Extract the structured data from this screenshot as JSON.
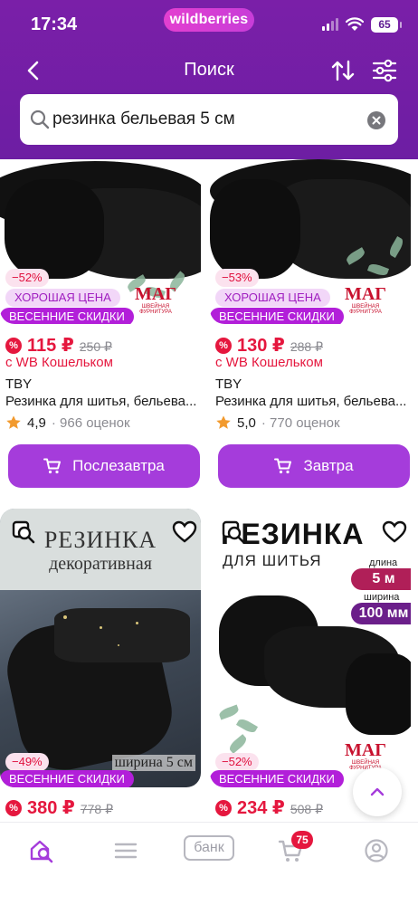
{
  "status_bar": {
    "time": "17:34",
    "brand": "wildberries",
    "battery": "65"
  },
  "nav": {
    "title": "Поиск"
  },
  "search": {
    "query": "резинка бельевая 5 см"
  },
  "products": [
    {
      "discount": "−52%",
      "good_price": "ХОРОШАЯ ЦЕНА",
      "sale": "ВЕСЕННИЕ СКИДКИ",
      "logo": "МАГ",
      "logo_sub": "ШВЕЙНАЯ ФУРНИТУРА",
      "price": "115 ₽",
      "old_price": "250 ₽",
      "wallet": "с WB Кошельком",
      "brand": "TBY",
      "name": "Резинка для шитья, бельева...",
      "rating": "4,9",
      "reviews": "· 966 оценок",
      "delivery": "Послезавтра"
    },
    {
      "discount": "−53%",
      "good_price": "ХОРОШАЯ ЦЕНА",
      "sale": "ВЕСЕННИЕ СКИДКИ",
      "logo": "МАГ",
      "logo_sub": "ШВЕЙНАЯ ФУРНИТУРА",
      "price": "130 ₽",
      "old_price": "288 ₽",
      "wallet": "с WB Кошельком",
      "brand": "TBY",
      "name": "Резинка для шитья, бельева...",
      "rating": "5,0",
      "reviews": "· 770 оценок",
      "delivery": "Завтра"
    },
    {
      "img_title": "РЕЗИНКА",
      "img_subtitle": "декоративная",
      "img_width": "ширина 5 см",
      "discount": "−49%",
      "sale": "ВЕСЕННИЕ СКИДКИ",
      "price": "380 ₽",
      "old_price": "778 ₽"
    },
    {
      "img_title": "РЕЗИНКА",
      "img_subtitle": "ДЛЯ ШИТЬЯ",
      "length_label": "длина",
      "length_value": "5 м",
      "width_label": "ширина",
      "width_value": "100 мм",
      "discount": "−52%",
      "sale": "ВЕСЕННИЕ СКИДКИ",
      "logo": "МАГ",
      "logo_sub": "ШВЕЙНАЯ ФУРНИТУРА",
      "price": "234 ₽",
      "old_price": "508 ₽"
    }
  ],
  "bottom_nav": {
    "bank": "банк",
    "cart_count": "75"
  },
  "colors": {
    "header": "#7a1fa8",
    "accent": "#a53cdb",
    "price": "#e5173e"
  }
}
